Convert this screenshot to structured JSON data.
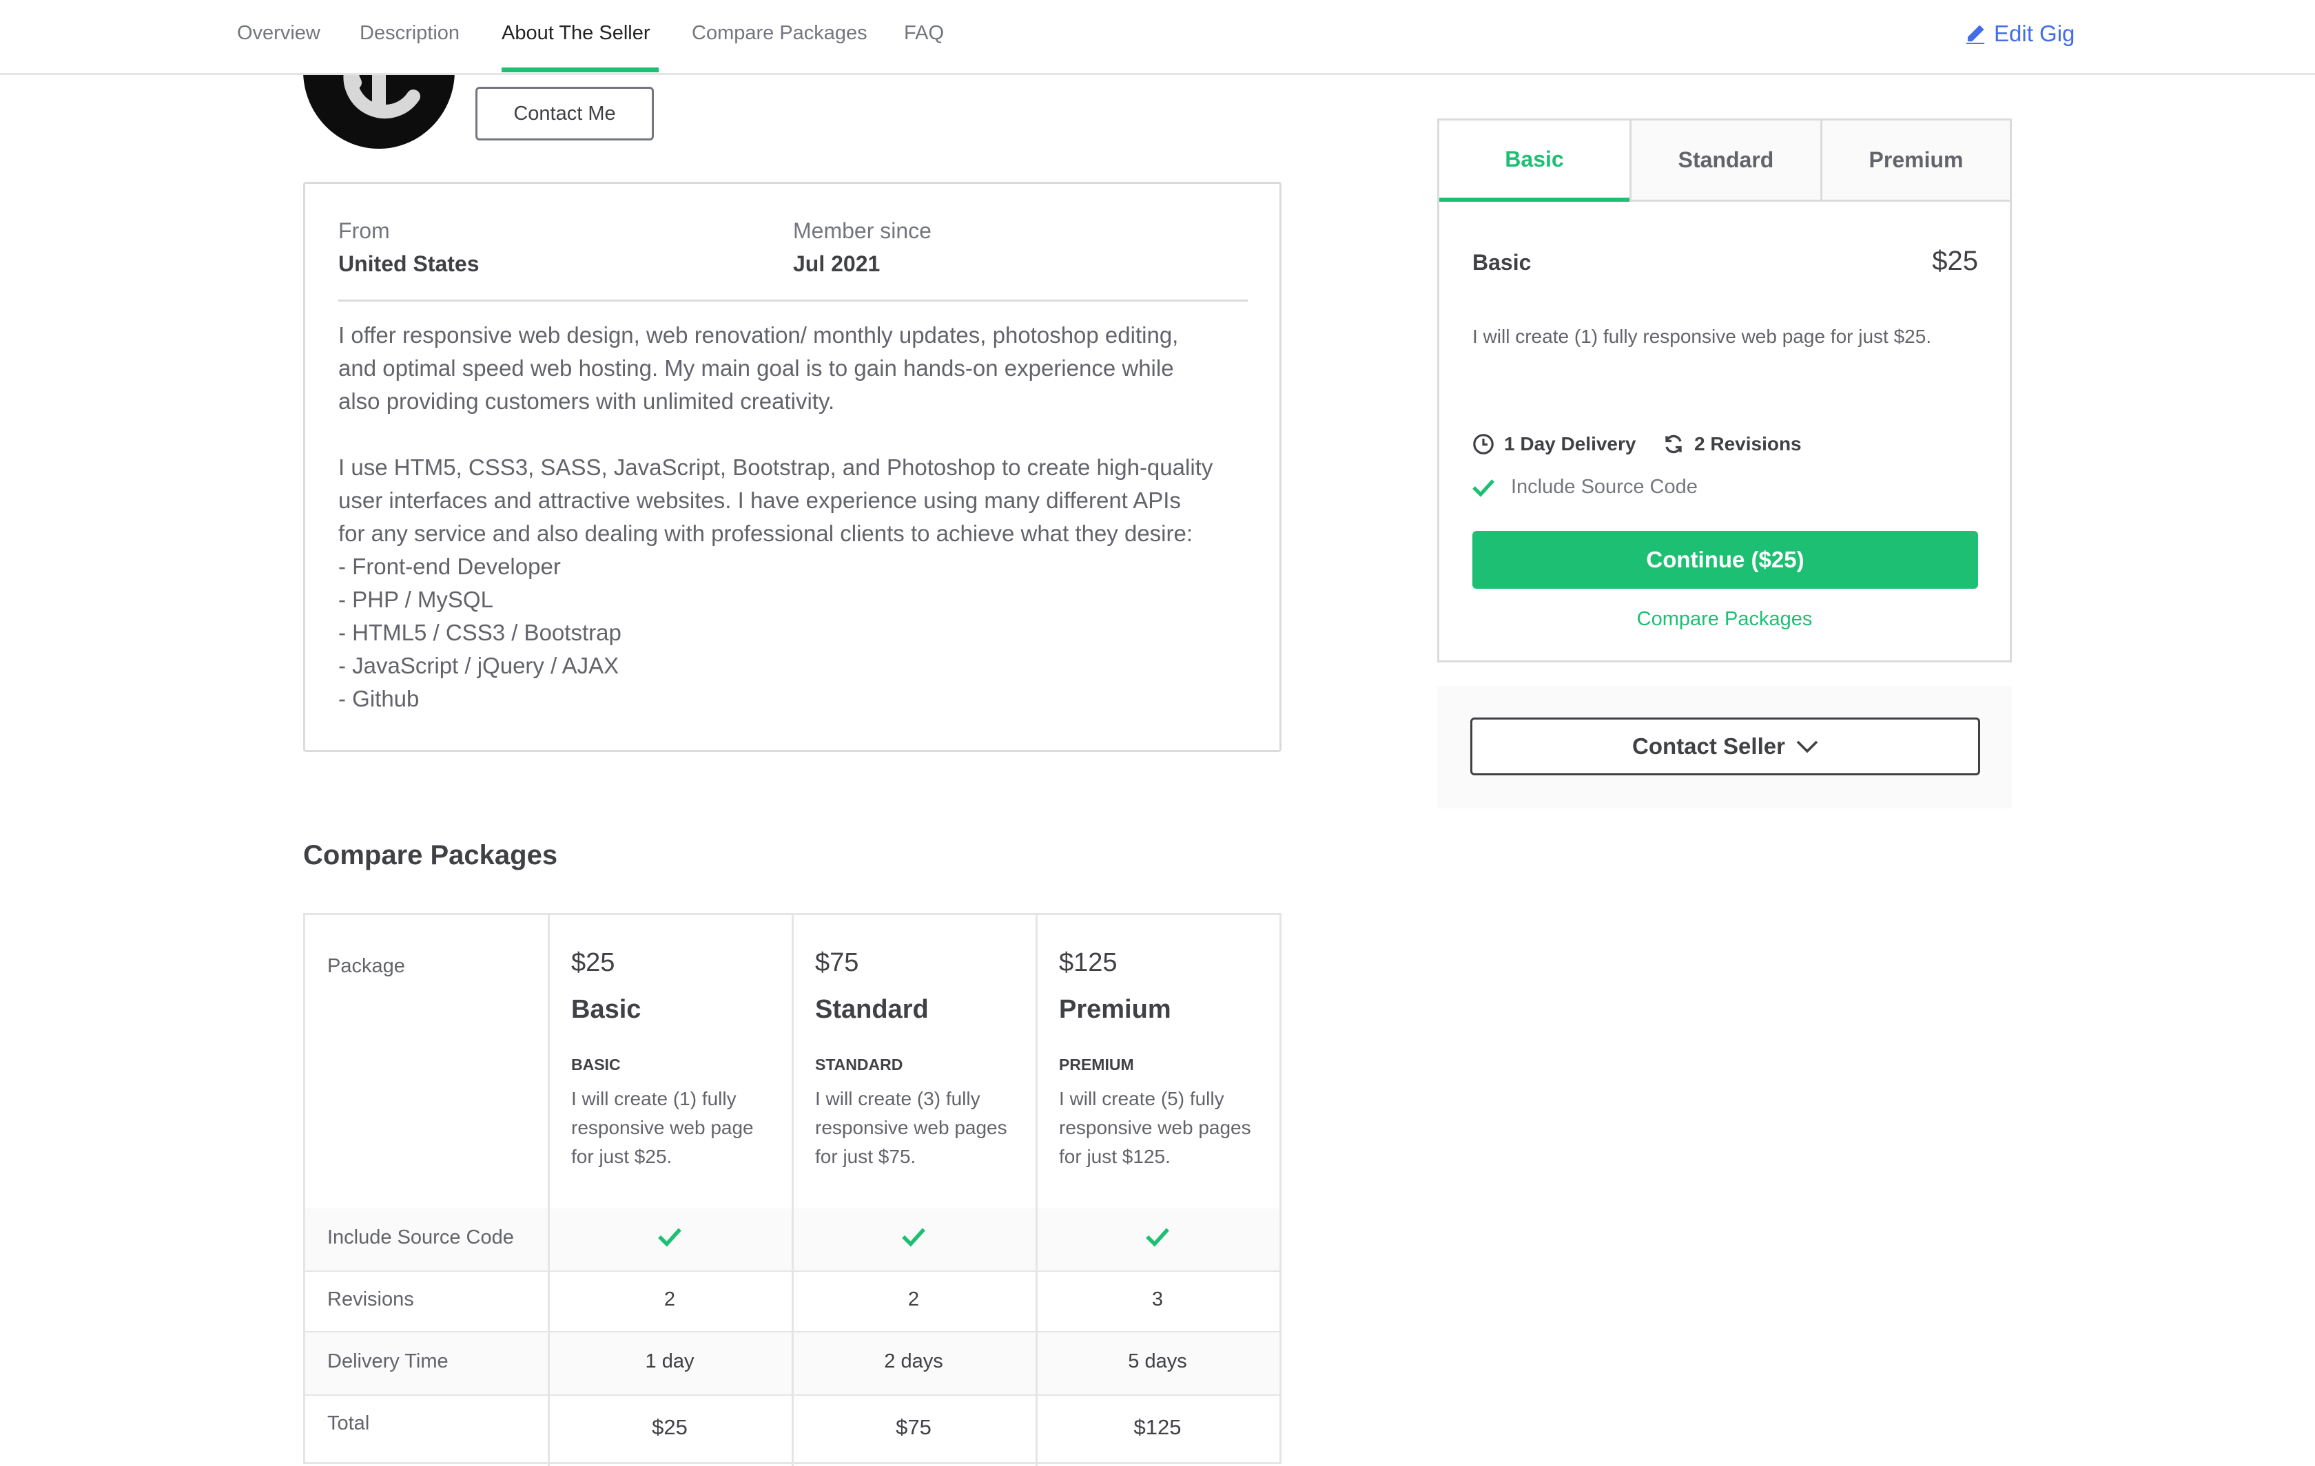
{
  "nav": {
    "tabs": [
      "Overview",
      "Description",
      "About The Seller",
      "Compare Packages",
      "FAQ"
    ],
    "active_index": 2,
    "edit_gig": "Edit Gig"
  },
  "seller": {
    "contact_me": "Contact Me",
    "from_label": "From",
    "from_value": "United States",
    "member_label": "Member since",
    "member_value": "Jul 2021",
    "description": [
      "I offer responsive web design, web renovation/ monthly updates, photoshop editing,",
      "and optimal speed web hosting. My main goal is to gain hands-on experience while",
      "also providing customers with unlimited creativity.",
      "",
      "I use HTM5, CSS3, SASS, JavaScript, Bootstrap, and Photoshop to create high-quality",
      "user interfaces and attractive websites. I have experience using many different APIs",
      "for any service and also dealing with professional clients to achieve what they desire:",
      "- Front-end Developer",
      "- PHP / MySQL",
      "- HTML5 / CSS3 / Bootstrap",
      "- JavaScript / jQuery / AJAX",
      "- Github"
    ]
  },
  "compare": {
    "title": "Compare Packages",
    "package_label": "Package",
    "packages": [
      {
        "price": "$25",
        "name": "Basic",
        "tag": "BASIC",
        "desc": "I will create (1) fully responsive web page for just $25.",
        "revisions": "2",
        "delivery": "1 day",
        "total": "$25",
        "source_code": true
      },
      {
        "price": "$75",
        "name": "Standard",
        "tag": "STANDARD",
        "desc": "I will create (3) fully responsive web pages for just $75.",
        "revisions": "2",
        "delivery": "2 days",
        "total": "$75",
        "source_code": true
      },
      {
        "price": "$125",
        "name": "Premium",
        "tag": "PREMIUM",
        "desc": "I will create (5) fully responsive web pages for just $125.",
        "revisions": "3",
        "delivery": "5 days",
        "total": "$125",
        "source_code": true
      }
    ],
    "rows": {
      "source_code": "Include Source Code",
      "revisions": "Revisions",
      "delivery": "Delivery Time",
      "total": "Total"
    }
  },
  "sidebar": {
    "tabs": [
      "Basic",
      "Standard",
      "Premium"
    ],
    "active_tab": 0,
    "package_name": "Basic",
    "package_price": "$25",
    "package_desc": "I will create (1) fully responsive web page for just $25.",
    "delivery": "1 Day Delivery",
    "revisions": "2 Revisions",
    "feature": "Include Source Code",
    "continue": "Continue ($25)",
    "compare_link": "Compare Packages",
    "contact_seller": "Contact Seller"
  },
  "colors": {
    "accent_green": "#1dbf73",
    "link_blue": "#446ee7",
    "text_dark": "#404145",
    "text_muted": "#62646a"
  }
}
